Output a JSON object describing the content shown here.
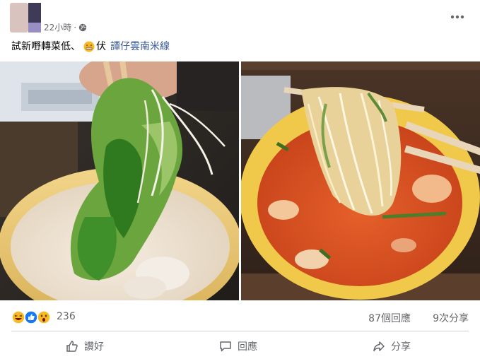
{
  "post": {
    "timestamp": "22小時",
    "dot": "·",
    "caption_text": "試新嘢轉菜低、",
    "caption_suffix": "伏",
    "tag": "譚仔雲南米線"
  },
  "reactions": {
    "count": "236",
    "types": [
      "haha-icon",
      "like-icon",
      "wow-icon"
    ]
  },
  "stats": {
    "comments": "87個回應",
    "shares": "9次分享"
  },
  "actions": {
    "like": "讚好",
    "comment": "回應",
    "share": "分享"
  },
  "colors": {
    "link": "#385898",
    "secondary_text": "#65676b",
    "like_blue": "#1877f2",
    "reaction_yellow": "#f7b928"
  }
}
